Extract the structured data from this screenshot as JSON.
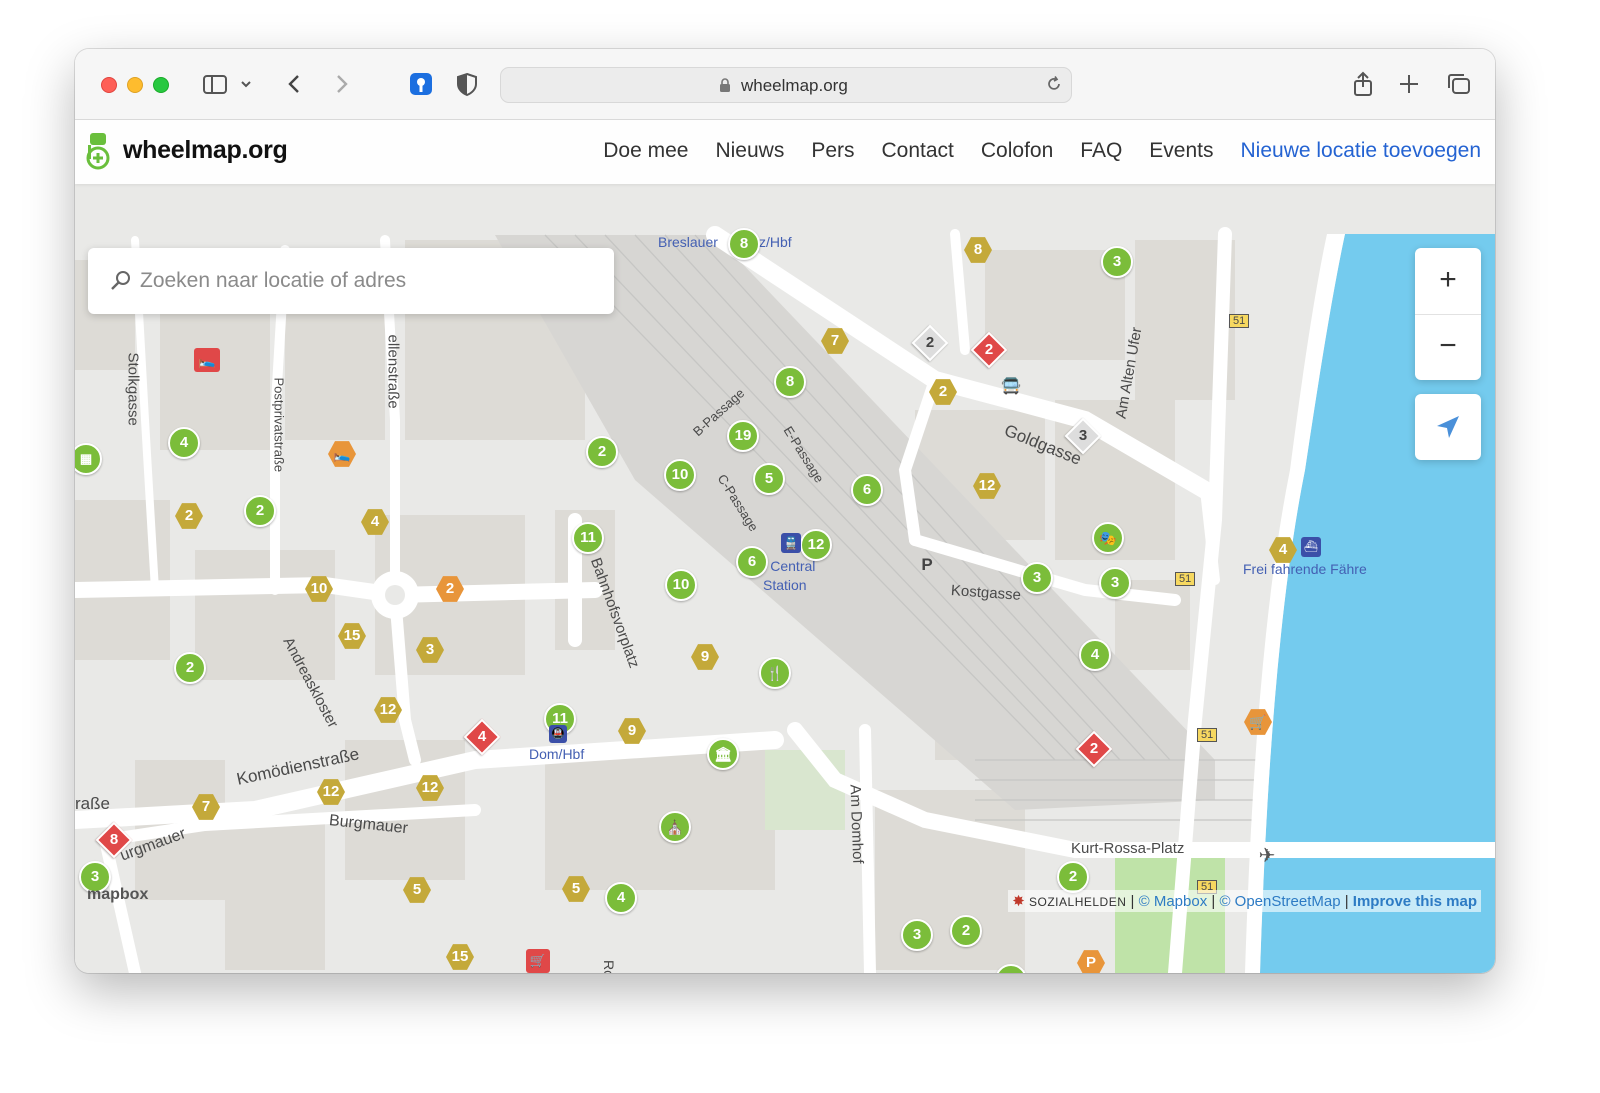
{
  "browser": {
    "url": "wheelmap.org"
  },
  "site": {
    "logo_text": "wheelmap.org",
    "nav": [
      "Doe mee",
      "Nieuws",
      "Pers",
      "Contact",
      "Colofon",
      "FAQ",
      "Events",
      "Nieuwe locatie toevoegen"
    ]
  },
  "search": {
    "placeholder": "Zoeken naar locatie of adres"
  },
  "zoom": {
    "in_label": "+",
    "out_label": "−"
  },
  "map": {
    "streets": [
      "Breslauer",
      "z/Hbf",
      "Stolkgasse",
      "Postprivatstraße",
      "ellenstraße",
      "B-Passage",
      "E-Passage",
      "C-Passage",
      "Goldgasse",
      "Am Alten Ufer",
      "Bahnhofsvorplatz",
      "Kostgasse",
      "Andreaskloster",
      "Komödienstraße",
      "raße",
      "urgmauer",
      "Burgmauer",
      "Am Domhof",
      "Kurt-Rossa-Platz",
      "Roncall"
    ],
    "pois": [
      "gne Central",
      "Station",
      "Dom/Hbf",
      "Frei fahrende Fähre"
    ],
    "route_badges": [
      "51",
      "51",
      "51",
      "51"
    ],
    "markers": [
      "8",
      "8",
      "3",
      "7",
      "2",
      "2",
      "2",
      "8",
      "19",
      "2",
      "3",
      "12",
      "4",
      "2",
      "10",
      "5",
      "6",
      "4",
      "6",
      "11",
      "12",
      "2",
      "10",
      "3",
      "10",
      "2",
      "3",
      "15",
      "3",
      "9",
      "4",
      "12",
      "11",
      "9",
      "2",
      "4",
      "7",
      "12",
      "12",
      "8",
      "3",
      "5",
      "5",
      "4",
      "2",
      "3",
      "2",
      "2",
      "3",
      "15",
      "4"
    ]
  },
  "attribution": {
    "mapbox_logo": "mapbox",
    "sozialhelden": "SOZIALHELDEN",
    "separator": " | ",
    "mapbox": "© Mapbox",
    "osm": "© OpenStreetMap",
    "improve": "Improve this map"
  }
}
